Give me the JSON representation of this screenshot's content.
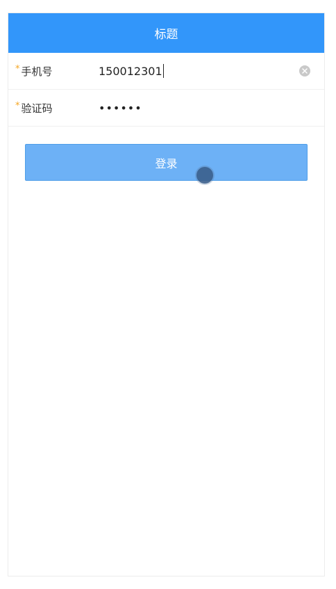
{
  "header": {
    "title": "标题"
  },
  "form": {
    "phone": {
      "required_mark": "*",
      "label": "手机号",
      "value": "150012301"
    },
    "code": {
      "required_mark": "*",
      "label": "验证码",
      "value": "••••••"
    }
  },
  "login_button": {
    "label": "登录"
  },
  "colors": {
    "navbar": "#3296fa",
    "button": "#6db1f6",
    "required_mark": "#f5a623"
  }
}
